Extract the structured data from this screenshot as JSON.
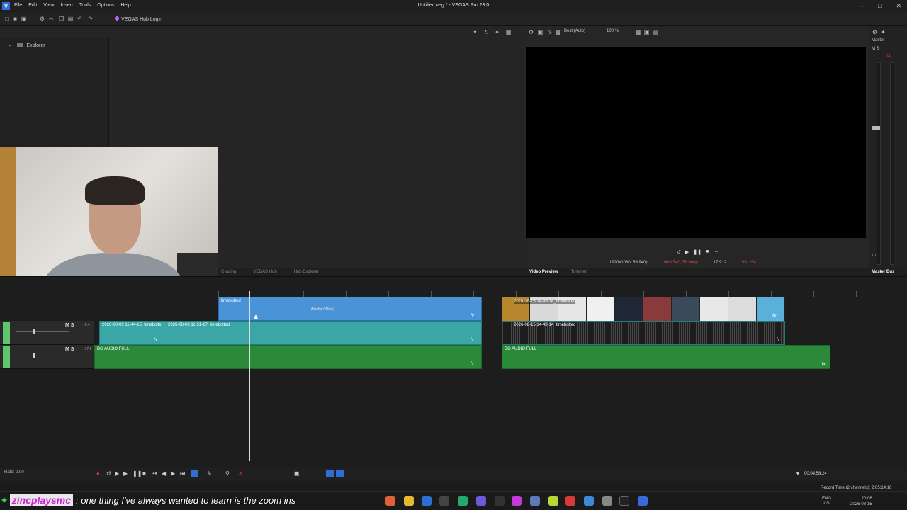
{
  "app": {
    "title": "Untitled.veg * - VEGAS Pro 23.0",
    "logo": "V",
    "menu": [
      "File",
      "Edit",
      "View",
      "Insert",
      "Tools",
      "Options",
      "Help"
    ],
    "hub_login": "VEGAS Hub Login"
  },
  "explorer": {
    "root_label": "Explorer"
  },
  "lower_tabs": [
    "Grading",
    "VEGAS Hub",
    "Hub Explorer"
  ],
  "preview": {
    "quality": "Best (Auto)",
    "zoom": "100 %",
    "project_info": "1920x1080, 59.940p",
    "preview_info": "960x540, 59.940p",
    "frame": "17,912",
    "display": "961x541",
    "tabs": {
      "active": "Video Preview",
      "inactive": "Trimmer"
    }
  },
  "master": {
    "label": "Master",
    "ms": "M S",
    "peak": "0.1",
    "value": "0.0",
    "tab": "Master Bus"
  },
  "timeline": {
    "tracks": [
      {
        "ms": "M S",
        "vol": "-0.4",
        "color": "#5fc76a"
      },
      {
        "ms": "M S",
        "vol": "-17.6",
        "color": "#5fc76a"
      }
    ],
    "clips": {
      "video1_label": "timebolted",
      "media_offline": "(Media Offline)",
      "video2_label": "2026-08-15 14-49-14_timebolted",
      "audio1_label": "2026-08-03 11-44-15_timebolte",
      "audio2_label": "2026-08-03 11-51-27_timebolted",
      "audio3_label": "2026-08-15 14-49-14_timebolted",
      "bg_audio_label": "BG AUDIO FULL",
      "bg_audio_label2": "BG AUDIO FULL",
      "fx": "fx"
    },
    "rate": "Rate: 0.00",
    "timecode": "00:04:58;24"
  },
  "status": {
    "record_time": "Record Time (2 channels): 2:05:14:16"
  },
  "overlay": {
    "username": "zincplaysmc",
    "message": ": one thing I've always wanted to learn is the zoom ins"
  },
  "taskbar": {
    "lang_top": "ENG",
    "lang_bottom": "US",
    "time": "20:06",
    "date": "2026-08-15"
  }
}
